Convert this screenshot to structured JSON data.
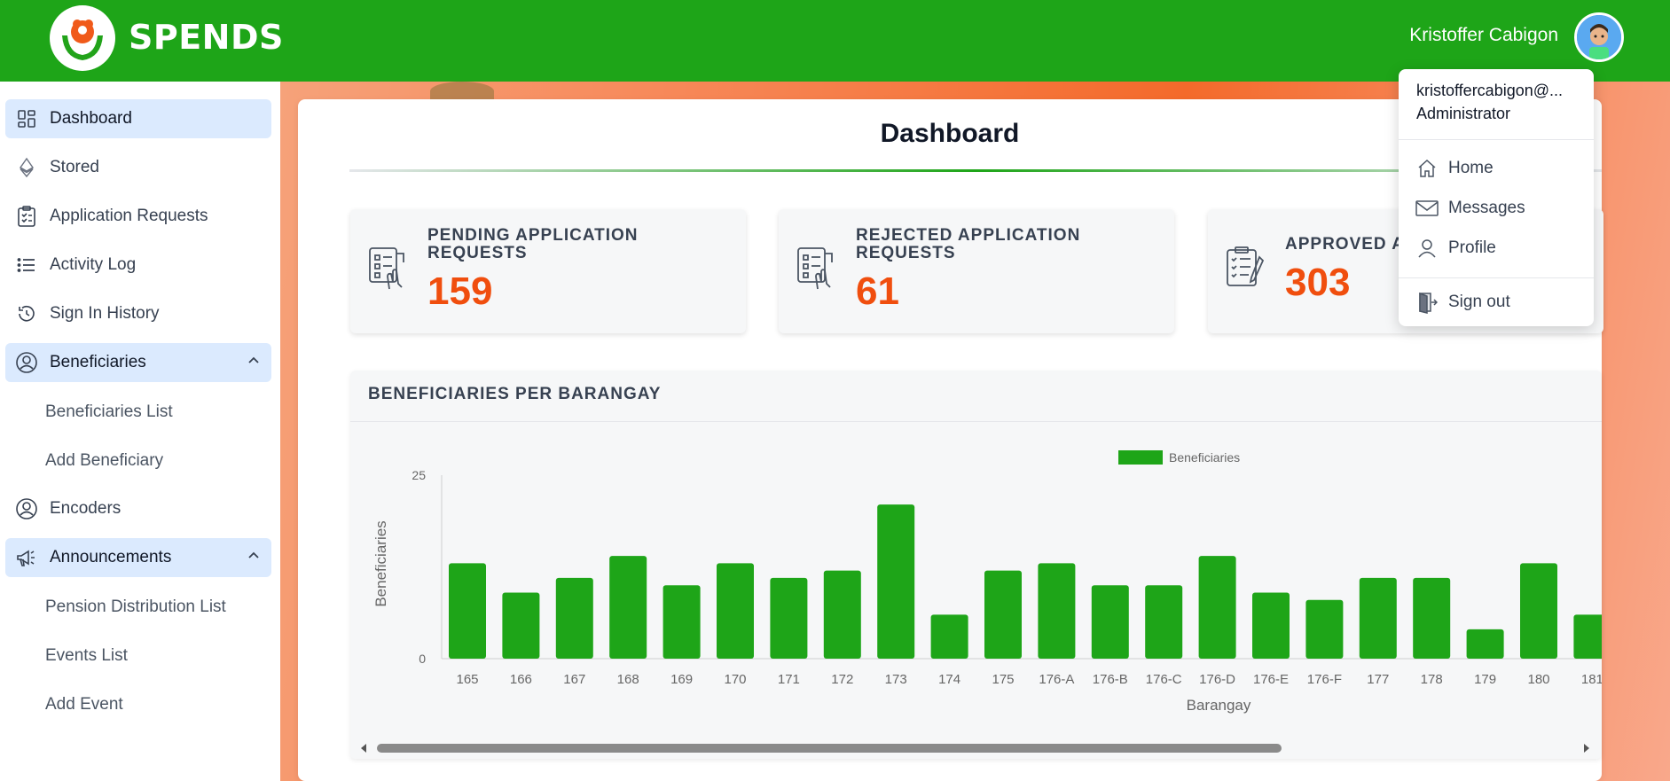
{
  "header": {
    "brand": "SPENDS",
    "user_name": "Kristoffer Cabigon",
    "brand_color": "#1ea518"
  },
  "sidebar": {
    "items": [
      {
        "label": "Dashboard",
        "icon": "grid-icon",
        "active": true
      },
      {
        "label": "Stored",
        "icon": "ethereum-icon"
      },
      {
        "label": "Application Requests",
        "icon": "clipboard-list-icon"
      },
      {
        "label": "Activity Log",
        "icon": "list-icon"
      },
      {
        "label": "Sign In History",
        "icon": "history-icon"
      },
      {
        "label": "Beneficiaries",
        "icon": "user-circle-icon",
        "expanded": true
      },
      {
        "label": "Beneficiaries List"
      },
      {
        "label": "Add Beneficiary"
      },
      {
        "label": "Encoders",
        "icon": "user-circle-icon"
      },
      {
        "label": "Announcements",
        "icon": "megaphone-icon",
        "expanded": true
      },
      {
        "label": "Pension Distribution List"
      },
      {
        "label": "Events List"
      },
      {
        "label": "Add Event"
      }
    ]
  },
  "main": {
    "title": "Dashboard",
    "stats": [
      {
        "label": "PENDING APPLICATION REQUESTS",
        "value": "159"
      },
      {
        "label": "REJECTED APPLICATION REQUESTS",
        "value": "61"
      },
      {
        "label": "APPROVED A",
        "value": "303"
      }
    ],
    "chart_card_title": "BENEFICIARIES PER BARANGAY"
  },
  "dropdown": {
    "email": "kristoffercabigon@...",
    "role": "Administrator",
    "items": [
      "Home",
      "Messages",
      "Profile",
      "Sign out"
    ]
  },
  "chart_data": {
    "type": "bar",
    "title": "",
    "xlabel": "Barangay",
    "ylabel": "Beneficiaries",
    "ylim": [
      0,
      25
    ],
    "yticks": [
      0,
      25
    ],
    "legend": "top-center",
    "grid": false,
    "categories": [
      "165",
      "166",
      "167",
      "168",
      "169",
      "170",
      "171",
      "172",
      "173",
      "174",
      "175",
      "176-A",
      "176-B",
      "176-C",
      "176-D",
      "176-E",
      "176-F",
      "177",
      "178",
      "179",
      "180",
      "181"
    ],
    "series": [
      {
        "name": "Beneficiaries",
        "color": "#1ea518",
        "values": [
          13,
          9,
          11,
          14,
          10,
          13,
          11,
          12,
          21,
          6,
          12,
          13,
          10,
          10,
          14,
          9,
          8,
          11,
          11,
          4,
          13,
          6
        ]
      }
    ]
  }
}
